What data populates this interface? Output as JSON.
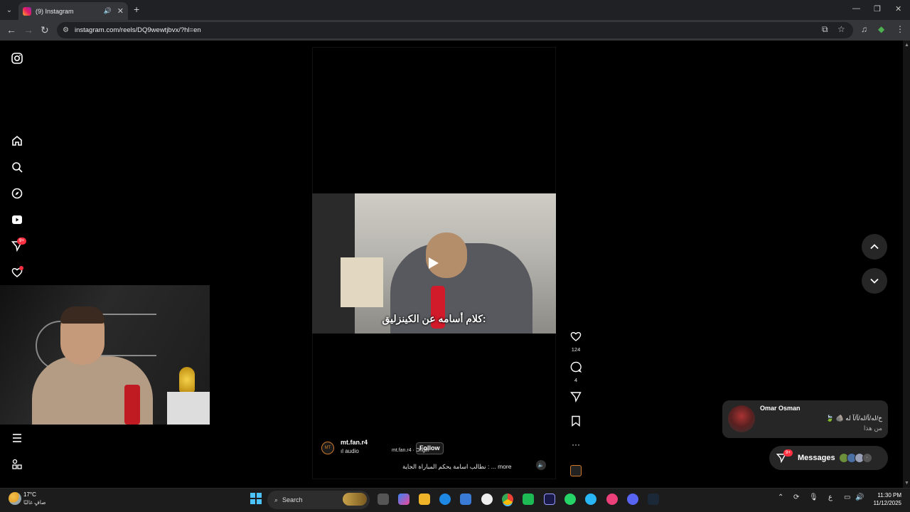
{
  "browser": {
    "tab_title": "(9) Instagram",
    "url": "instagram.com/reels/DQ9wewtjbvx/?hl=en",
    "icons": [
      "tab-search-icon",
      "audio-icon",
      "close-icon",
      "new-tab-icon",
      "back-icon",
      "forward-icon",
      "reload-icon",
      "site-info-icon",
      "cast-icon",
      "bookmark-star-icon",
      "media-control-icon",
      "extension-icon",
      "menu-icon"
    ]
  },
  "sidebar": {
    "notification_badge": "9+",
    "items": [
      "instagram-logo",
      "home",
      "search",
      "explore",
      "reels",
      "messages",
      "notifications",
      "more",
      "also-from-meta"
    ]
  },
  "reel": {
    "subtitle": "كلام أسامه عن الكينزليق:",
    "username": "mt.fan.r4",
    "audio": "ıl audio",
    "audio_secondary": "mt.fan.r4 · Origin",
    "follow_label": "Follow",
    "caption": "نطالب اسامة يحكم المباراة الجاية : ... more",
    "avatar_text": "MT",
    "likes": "124",
    "comments": "4"
  },
  "notification": {
    "sender": "Omar Osman",
    "message": "خ/ﻟﻪ/ﺂ/ﻟﻪ/ﺂ/ﺂ ﻟﻪ 🪨 🍃",
    "subtext": "من هذا"
  },
  "messages_pill": {
    "label": "Messages",
    "badge": "9+"
  },
  "taskbar": {
    "temperature": "17°C",
    "weather_desc": "صافٍ غالبًا",
    "search_placeholder": "Search",
    "lang": "ع",
    "time": "11:30 PM",
    "date": "11/12/2025"
  },
  "colors": {
    "accent": "#ff3040",
    "panel": "#262626",
    "taskbar": "#1c1c1c"
  }
}
